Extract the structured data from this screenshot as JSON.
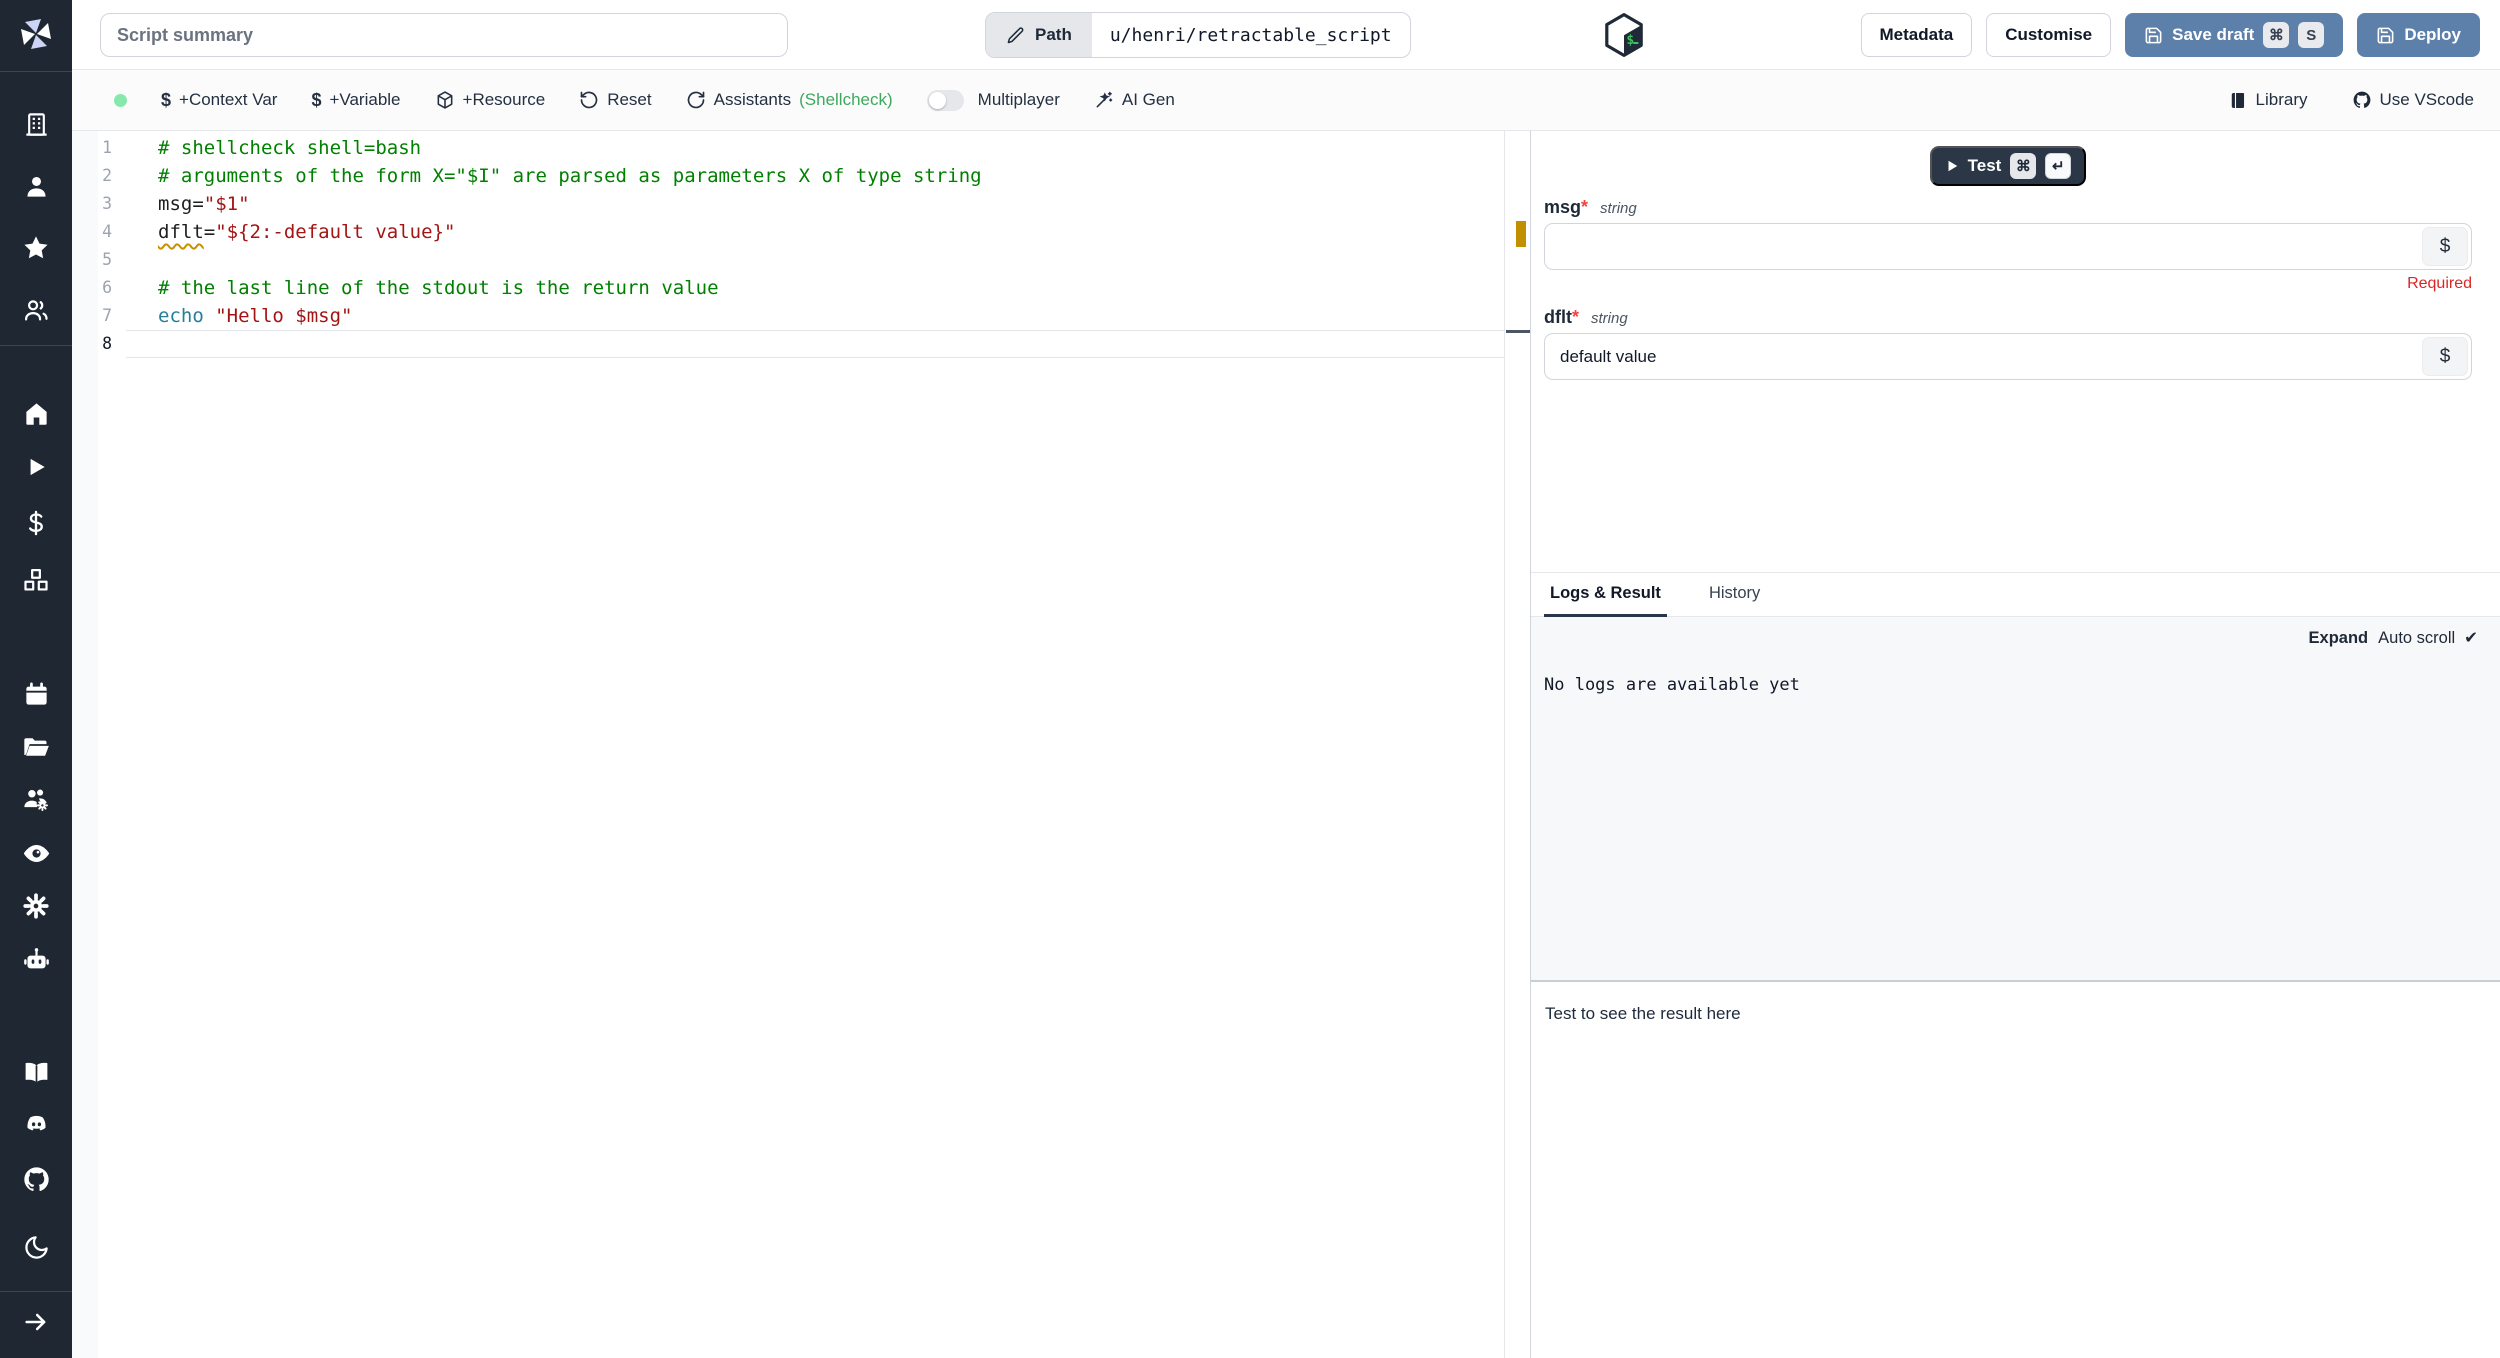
{
  "topbar": {
    "summary_placeholder": "Script summary",
    "path_label": "Path",
    "path_value": "u/henri/retractable_script",
    "language_badge": "bash-icon",
    "metadata_label": "Metadata",
    "customise_label": "Customise",
    "save_draft_label": "Save draft",
    "save_kbd": [
      "⌘",
      "S"
    ],
    "deploy_label": "Deploy"
  },
  "toolbar": {
    "context_var_label": "+Context Var",
    "variable_label": "+Variable",
    "resource_label": "+Resource",
    "reset_label": "Reset",
    "assistants_label": "Assistants",
    "assistants_badge": "(Shellcheck)",
    "multiplayer_label": "Multiplayer",
    "ai_gen_label": "AI Gen",
    "library_label": "Library",
    "use_vscode_label": "Use VScode",
    "dollar_glyph": "$"
  },
  "sidebar": {
    "icons": [
      "windmill-logo",
      "workspace-building",
      "user",
      "favorites-star",
      "groups",
      "home",
      "runs-play",
      "variables-dollar",
      "resources-boxes",
      "schedules-calendar",
      "folders",
      "groups-settings",
      "audit-eye",
      "settings-gear",
      "workers-robot",
      "docs-book",
      "discord",
      "github",
      "dark-mode-moon",
      "collapse-arrow-right"
    ]
  },
  "editor": {
    "lines": [
      {
        "num": "1",
        "active": false,
        "tokens": [
          {
            "t": "# shellcheck shell=bash",
            "c": "comment"
          }
        ]
      },
      {
        "num": "2",
        "active": false,
        "tokens": [
          {
            "t": "# arguments of the form X=\"$I\" are parsed as parameters X of type string",
            "c": "comment"
          }
        ]
      },
      {
        "num": "3",
        "active": false,
        "tokens": [
          {
            "t": "msg=",
            "c": "plain"
          },
          {
            "t": "\"$1\"",
            "c": "string"
          }
        ]
      },
      {
        "num": "4",
        "active": false,
        "tokens": [
          {
            "t": "dflt",
            "c": "warn"
          },
          {
            "t": "=",
            "c": "plain"
          },
          {
            "t": "\"${2:-default value}\"",
            "c": "string"
          }
        ]
      },
      {
        "num": "5",
        "active": false,
        "tokens": []
      },
      {
        "num": "6",
        "active": false,
        "tokens": [
          {
            "t": "# the last line of the stdout is the return value",
            "c": "comment"
          }
        ]
      },
      {
        "num": "7",
        "active": false,
        "tokens": [
          {
            "t": "echo ",
            "c": "builtin"
          },
          {
            "t": "\"Hello $msg\"",
            "c": "string"
          }
        ]
      },
      {
        "num": "8",
        "active": true,
        "tokens": []
      }
    ]
  },
  "form": {
    "test_label": "Test",
    "test_kbd": [
      "⌘",
      "↵"
    ],
    "dollar_button": "$",
    "fields": [
      {
        "name": "msg",
        "star": "*",
        "type": "string",
        "value": "",
        "error": "Required"
      },
      {
        "name": "dflt",
        "star": "*",
        "type": "string",
        "value": "default value",
        "error": ""
      }
    ]
  },
  "output": {
    "tabs": [
      "Logs & Result",
      "History"
    ],
    "active_tab": "Logs & Result",
    "expand_label": "Expand",
    "autoscroll_label": "Auto scroll",
    "autoscroll_check": "✔",
    "empty_logs": "No logs are available yet",
    "result_placeholder": "Test to see the result here"
  },
  "colors": {
    "sidebar_bg": "#1f2733",
    "accent_blue": "#5d80aa",
    "status_dot_green": "#86e8ac",
    "shellcheck_green": "#3fa95f",
    "required_red": "#dc2626",
    "warning_gold": "#c79100",
    "comment_green": "#008000",
    "string_red": "#a31515",
    "builtin_teal": "#267f99"
  }
}
